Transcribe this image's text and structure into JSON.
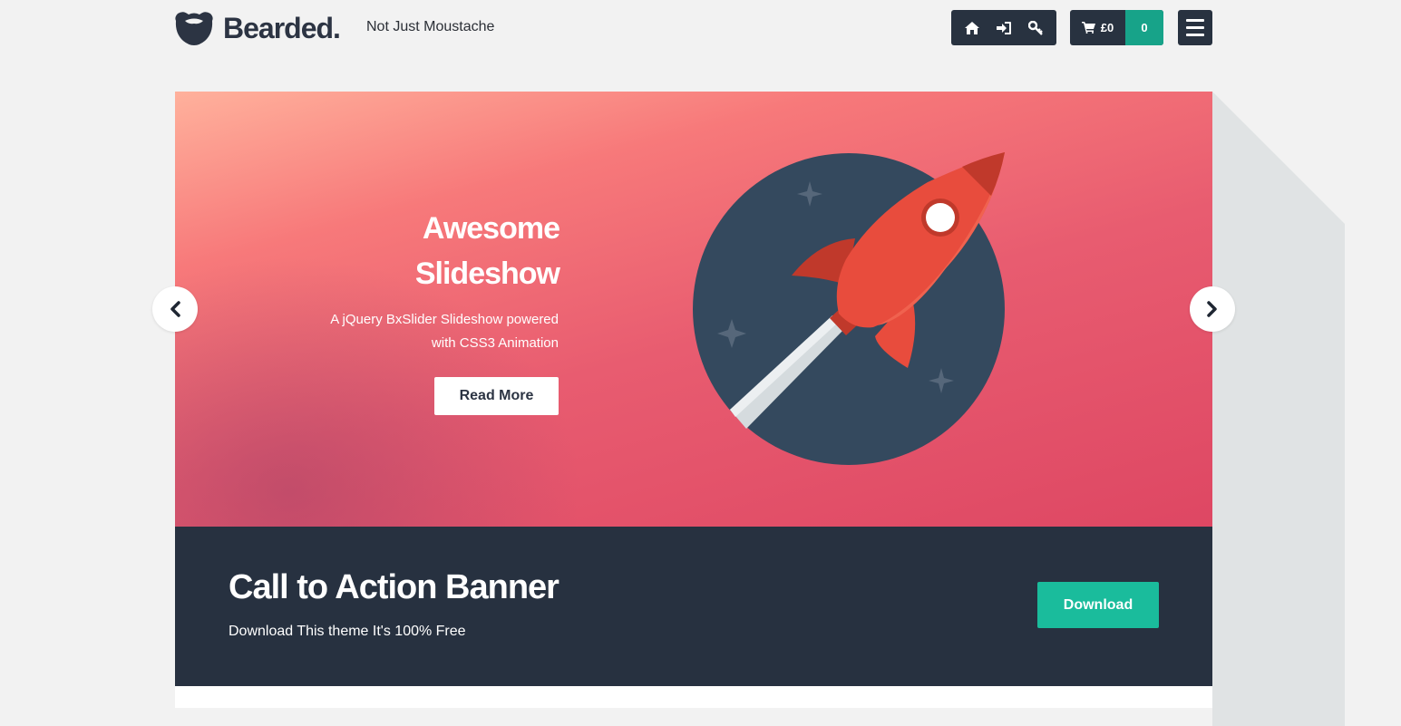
{
  "brand": {
    "name": "Bearded.",
    "tagline": "Not Just Moustache"
  },
  "header": {
    "nav_icons": [
      {
        "icon": "home-icon"
      },
      {
        "icon": "sign-in-icon"
      },
      {
        "icon": "key-icon"
      }
    ],
    "cart": {
      "icon": "shopping-cart-icon",
      "total": "£0",
      "count": "0"
    },
    "menu_icon": "hamburger-menu-icon"
  },
  "slider": {
    "title_line1": "Awesome",
    "title_line2": "Slideshow",
    "description_line1": "A jQuery BxSlider Slideshow powered",
    "description_line2": "with CSS3 Animation",
    "button_label": "Read More",
    "prev_icon": "chevron-left-icon",
    "next_icon": "chevron-right-icon",
    "illustration": "rocket-illustration"
  },
  "cta": {
    "title": "Call to Action Banner",
    "subtitle": "Download This theme It's 100% Free",
    "button_label": "Download"
  },
  "colors": {
    "background": "#f2f2f2",
    "dark": "#283240",
    "accent_green": "#1abc9c",
    "cart_green": "#17a389",
    "slide_gradient_start": "#ffb19c",
    "slide_gradient_end": "#de4763",
    "planet": "#34495e",
    "rocket": "#e84c3d"
  }
}
